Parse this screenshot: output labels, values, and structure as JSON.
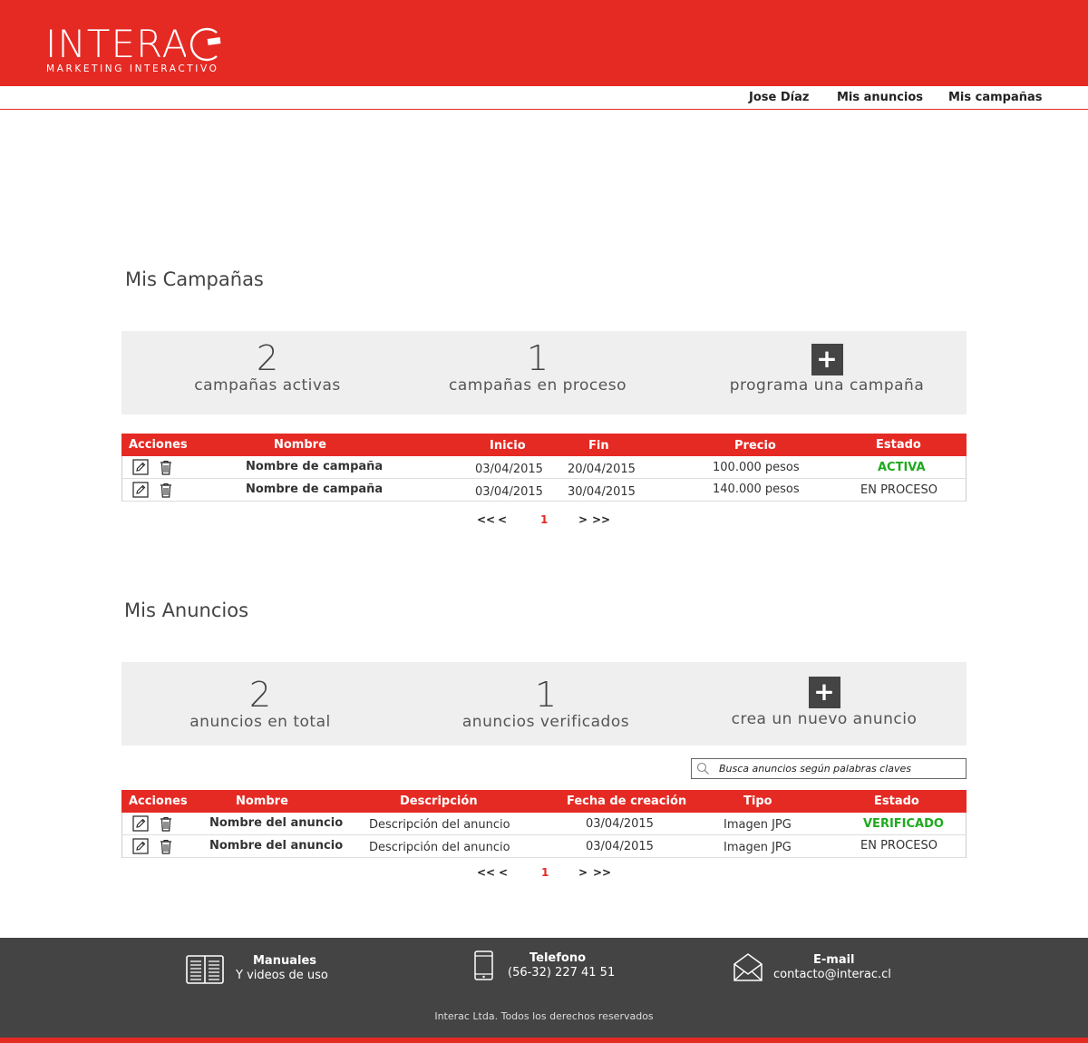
{
  "brand": {
    "logo_text": "INTERAC",
    "tagline": "MARKETING INTERACTIVO",
    "primary_color": "#e52a24",
    "dark_color": "#444444"
  },
  "nav": {
    "user": "Jose Díaz",
    "ads": "Mis anuncios",
    "campaigns": "Mis campañas"
  },
  "campaigns": {
    "title": "Mis Campañas",
    "stats": {
      "active_count": "2",
      "active_label": "campañas activas",
      "process_count": "1",
      "process_label": "campañas en proceso",
      "add_icon": "+",
      "add_label": "programa una campaña"
    },
    "table": {
      "headers": [
        "Acciones",
        "Nombre",
        "Inicio",
        "Fin",
        "Precio",
        "Estado"
      ],
      "rows": [
        {
          "name": "Nombre de campaña",
          "start": "03/04/2015",
          "end": "20/04/2015",
          "price": "100.000 pesos",
          "status": "ACTIVA",
          "status_color": "#1eaa1e"
        },
        {
          "name": "Nombre de campaña",
          "start": "03/04/2015",
          "end": "30/04/2015",
          "price": "140.000 pesos",
          "status": "EN PROCESO",
          "status_color": "#333333"
        }
      ]
    },
    "pager": {
      "first": "<<",
      "prev": "<",
      "current": "1",
      "next": ">",
      "last": ">>"
    }
  },
  "ads": {
    "title": "Mis Anuncios",
    "stats": {
      "total_count": "2",
      "total_label": "anuncios en total",
      "verified_count": "1",
      "verified_label": "anuncios verificados",
      "add_icon": "+",
      "add_label": "crea un nuevo anuncio"
    },
    "search_placeholder": "Busca anuncios según palabras claves",
    "table": {
      "headers": [
        "Acciones",
        "Nombre",
        "Descripción",
        "Fecha de creación",
        "Tipo",
        "Estado"
      ],
      "rows": [
        {
          "name": "Nombre del anuncio",
          "description": "Descripción del anuncio",
          "date": "03/04/2015",
          "type": "Imagen JPG",
          "status": "VERIFICADO",
          "status_color": "#1eaa1e"
        },
        {
          "name": "Nombre del anuncio",
          "description": "Descripción del anuncio",
          "date": "03/04/2015",
          "type": "Imagen JPG",
          "status": "EN PROCESO",
          "status_color": "#333333"
        }
      ]
    },
    "pager": {
      "first": "<<",
      "prev": "<",
      "current": "1",
      "next": ">",
      "last": ">>"
    }
  },
  "footer": {
    "manuals_title": "Manuales",
    "manuals_sub": "Y videos de uso",
    "phone_title": "Telefono",
    "phone_sub": "(56-32) 227 41 51",
    "email_title": "E-mail",
    "email_sub": "contacto@interac.cl",
    "copyright": "Interac Ltda. Todos los derechos reservados"
  }
}
